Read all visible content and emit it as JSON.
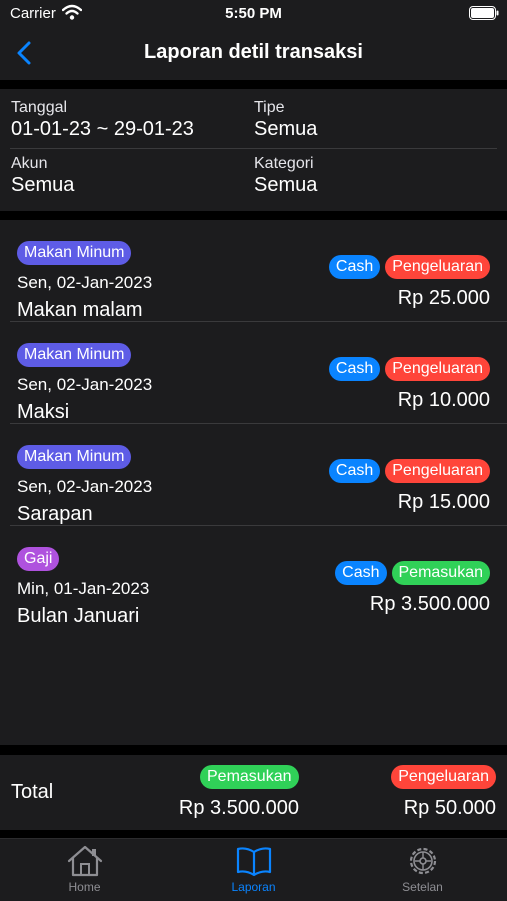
{
  "status": {
    "carrier": "Carrier",
    "time": "5:50 PM"
  },
  "nav": {
    "title": "Laporan detil transaksi"
  },
  "filters": {
    "tanggal_label": "Tanggal",
    "tanggal_value": "01-01-23 ~ 29-01-23",
    "tipe_label": "Tipe",
    "tipe_value": "Semua",
    "akun_label": "Akun",
    "akun_value": "Semua",
    "kategori_label": "Kategori",
    "kategori_value": "Semua"
  },
  "transactions": [
    {
      "category": "Makan Minum",
      "date": "Sen, 02-Jan-2023",
      "description": "Makan malam",
      "account": "Cash",
      "type": "Pengeluaran",
      "amount": "Rp 25.000"
    },
    {
      "category": "Makan Minum",
      "date": "Sen, 02-Jan-2023",
      "description": "Maksi",
      "account": "Cash",
      "type": "Pengeluaran",
      "amount": "Rp 10.000"
    },
    {
      "category": "Makan Minum",
      "date": "Sen, 02-Jan-2023",
      "description": "Sarapan",
      "account": "Cash",
      "type": "Pengeluaran",
      "amount": "Rp 15.000"
    },
    {
      "category": "Gaji",
      "date": "Min, 01-Jan-2023",
      "description": "Bulan Januari",
      "account": "Cash",
      "type": "Pemasukan",
      "amount": "Rp 3.500.000"
    }
  ],
  "total": {
    "label": "Total",
    "income_label": "Pemasukan",
    "income_value": "Rp 3.500.000",
    "expense_label": "Pengeluaran",
    "expense_value": "Rp 50.000"
  },
  "tabs": [
    {
      "label": "Home",
      "icon": "house-icon"
    },
    {
      "label": "Laporan",
      "icon": "book-icon"
    },
    {
      "label": "Setelan",
      "icon": "gear-icon"
    }
  ],
  "colors": {
    "accent": "#0a84ff",
    "category": "#5e5ce6",
    "category_alt": "#af52de",
    "expense": "#ff453a",
    "income": "#30d158",
    "background": "#1c1c1e"
  }
}
